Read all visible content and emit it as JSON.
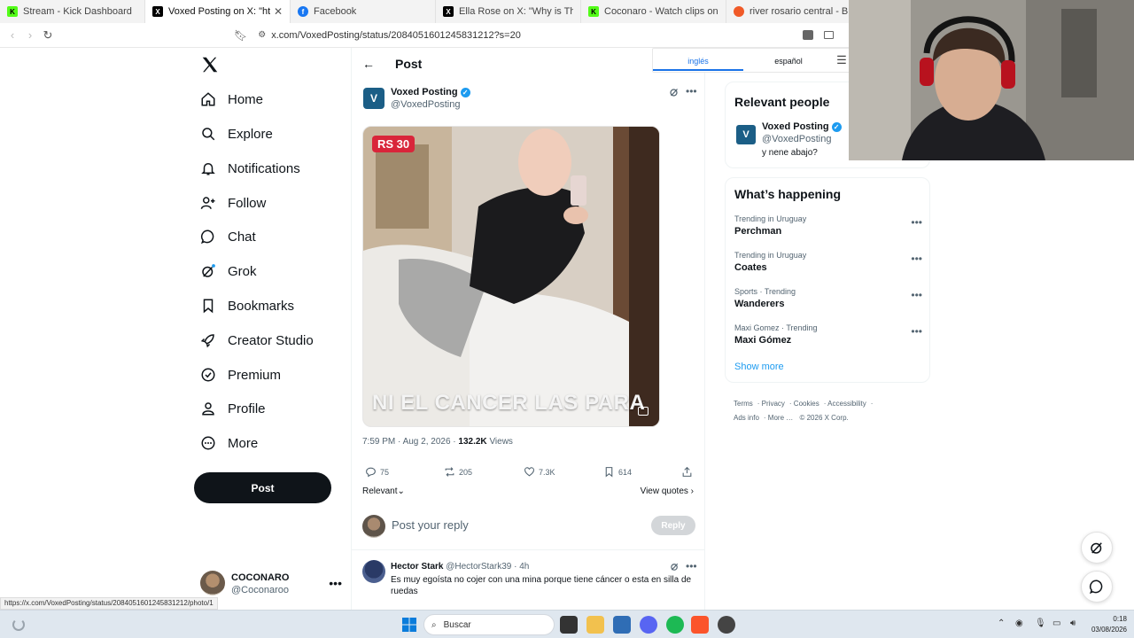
{
  "browser": {
    "tabs": [
      {
        "title": "Stream - Kick Dashboard",
        "favicon": "kick-icon",
        "color": "#53fc18",
        "active": false
      },
      {
        "title": "Voxed Posting on X: \"https://t.co",
        "favicon": "x-icon",
        "color": "#000000",
        "active": true
      },
      {
        "title": "Facebook",
        "favicon": "facebook-icon",
        "color": "#1877f2",
        "active": false
      },
      {
        "title": "Ella Rose on X: \"Why is Thor's age th",
        "favicon": "x-icon",
        "color": "#000000",
        "active": false
      },
      {
        "title": "Coconaro - Watch clips on Kick",
        "favicon": "kick-icon",
        "color": "#53fc18",
        "active": false
      },
      {
        "title": "river rosario central - Brave Sear",
        "favicon": "brave-search-icon",
        "color": "#f05a28",
        "active": false
      }
    ],
    "url": "x.com/VoxedPosting/status/2084051601245831212?s=20",
    "status_url": "https://x.com/VoxedPosting/status/2084051601245831212/photo/1"
  },
  "nav": {
    "items": [
      {
        "label": "Home",
        "icon": "home-icon"
      },
      {
        "label": "Explore",
        "icon": "search-icon"
      },
      {
        "label": "Notifications",
        "icon": "bell-icon"
      },
      {
        "label": "Follow",
        "icon": "follow-icon"
      },
      {
        "label": "Chat",
        "icon": "chat-icon"
      },
      {
        "label": "Grok",
        "icon": "grok-icon"
      },
      {
        "label": "Bookmarks",
        "icon": "bookmark-icon"
      },
      {
        "label": "Creator Studio",
        "icon": "rocket-icon"
      },
      {
        "label": "Premium",
        "icon": "premium-icon"
      },
      {
        "label": "Profile",
        "icon": "profile-icon"
      },
      {
        "label": "More",
        "icon": "more-circle-icon"
      }
    ],
    "post_button": "Post",
    "account": {
      "name": "COCONARO",
      "handle": "@Coconaroo"
    }
  },
  "post": {
    "header_title": "Post",
    "author_initial": "V",
    "author_name": "Voxed Posting",
    "author_handle": "@VoxedPosting",
    "media_tag": "RS 30",
    "media_caption": "NI EL CANCER LAS PARA",
    "time": "7:59 PM · Aug 2, 2026",
    "views_count": "132.2K",
    "views_label": "Views",
    "stats": {
      "replies": "75",
      "reposts": "205",
      "likes": "7.3K",
      "bookmarks": "614"
    },
    "sort_label": "Relevant",
    "view_quotes": "View quotes",
    "reply_placeholder": "Post your reply",
    "reply_button": "Reply"
  },
  "reply": {
    "name": "Hector Stark",
    "handle": "@HectorStark39",
    "age": "4h",
    "text": "Es muy egoísta no cojer con una mina porque tiene cáncer o esta en silla de ruedas"
  },
  "translate_bar": {
    "source": "inglés",
    "target": "español"
  },
  "relevant_people": {
    "title": "Relevant people",
    "initial": "V",
    "name": "Voxed Posting",
    "handle": "@VoxedPosting",
    "bio": "y nene abajo?"
  },
  "whats_happening": {
    "title": "What’s happening",
    "trends": [
      {
        "context": "Trending in Uruguay",
        "name": "Perchman"
      },
      {
        "context": "Trending in Uruguay",
        "name": "Coates"
      },
      {
        "context": "Sports · Trending",
        "name": "Wanderers"
      },
      {
        "context": "Maxi Gomez · Trending",
        "name": "Maxi Gómez"
      }
    ],
    "show_more": "Show more"
  },
  "footer": {
    "links": [
      "Terms",
      "Privacy",
      "Cookies",
      "Accessibility",
      "Ads info",
      "More …"
    ],
    "copyright": "© 2026 X Corp."
  },
  "taskbar": {
    "search_placeholder": "Buscar",
    "time": "0:18",
    "date": "03/08/2026"
  },
  "colors": {
    "x_blue": "#1d9bf0",
    "ink": "#0f1419",
    "muted": "#536471"
  }
}
